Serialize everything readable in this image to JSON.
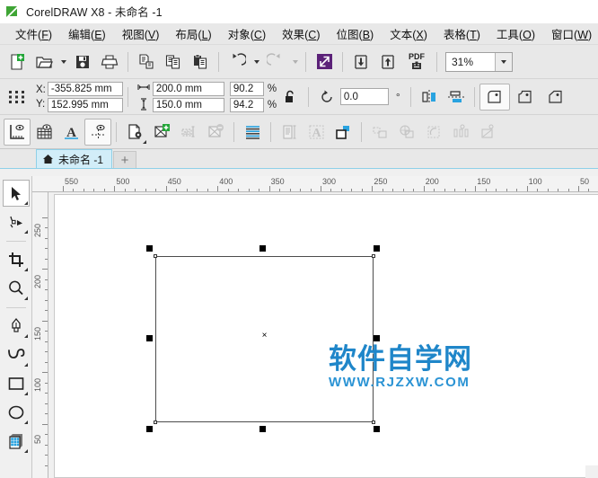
{
  "window": {
    "title": "CorelDRAW X8 - 未命名 -1",
    "logo_icon": "coreldraw-logo-icon"
  },
  "menubar": {
    "items": [
      {
        "label": "文件",
        "accel": "F"
      },
      {
        "label": "编辑",
        "accel": "E"
      },
      {
        "label": "视图",
        "accel": "V"
      },
      {
        "label": "布局",
        "accel": "L"
      },
      {
        "label": "对象",
        "accel": "C"
      },
      {
        "label": "效果",
        "accel": "C"
      },
      {
        "label": "位图",
        "accel": "B"
      },
      {
        "label": "文本",
        "accel": "X"
      },
      {
        "label": "表格",
        "accel": "T"
      },
      {
        "label": "工具",
        "accel": "O"
      },
      {
        "label": "窗口",
        "accel": "W"
      }
    ]
  },
  "main_toolbar": {
    "buttons": [
      {
        "name": "new-document-button",
        "icon": "new-page-icon"
      },
      {
        "name": "open-document-button",
        "icon": "open-folder-icon"
      },
      {
        "name": "save-document-button",
        "icon": "floppy-save-icon"
      },
      {
        "name": "print-button",
        "icon": "printer-icon"
      },
      {
        "name": "cut-button",
        "icon": "cut-icon"
      },
      {
        "name": "copy-button",
        "icon": "copy-icon"
      },
      {
        "name": "paste-button",
        "icon": "paste-icon"
      },
      {
        "name": "undo-button",
        "icon": "undo-arrow-icon"
      },
      {
        "name": "redo-button",
        "icon": "redo-arrow-icon"
      },
      {
        "name": "search-content-button",
        "icon": "fullscreen-arrows-icon"
      },
      {
        "name": "import-button",
        "icon": "import-down-arrow-icon"
      },
      {
        "name": "export-button",
        "icon": "export-up-arrow-icon"
      },
      {
        "name": "publish-pdf-button",
        "icon": "pdf-icon"
      }
    ],
    "pdf_label": "PDF",
    "zoom": {
      "value": "31%",
      "name": "zoom-level-combo"
    }
  },
  "property_bar": {
    "object_position_icon": "object-handles-icon",
    "x_label": "X:",
    "y_label": "Y:",
    "x_value": "-355.825 mm",
    "y_value": "152.995 mm",
    "width_value": "200.0 mm",
    "height_value": "150.0 mm",
    "width_icon": "horizontal-size-icon",
    "height_icon": "vertical-size-icon",
    "scale_x": "90.2",
    "scale_y": "94.2",
    "percent_symbol": "%",
    "lock_ratio_icon": "lock-open-icon",
    "rotation_icon": "rotation-icon",
    "rotation_value": "0.0",
    "degree_symbol": "°",
    "mirror_horizontal_icon": "mirror-horizontal-icon",
    "mirror_vertical_icon": "mirror-vertical-icon",
    "corner_round_icon": "round-corner-icon",
    "corner_scallop_icon": "scallop-corner-icon",
    "corner_chamfer_icon": "chamfer-corner-icon"
  },
  "third_toolbar": {
    "buttons": [
      {
        "name": "show-rulers-button",
        "icon": "ruler-eye-icon",
        "state": "pressed"
      },
      {
        "name": "show-grid-button",
        "icon": "grid-eye-icon",
        "state": "normal"
      },
      {
        "name": "show-text-button",
        "icon": "text-baseline-icon",
        "state": "normal"
      },
      {
        "name": "show-guidelines-button",
        "icon": "guideline-eye-icon",
        "state": "pressed"
      },
      {
        "name": "document-options-button",
        "icon": "page-gear-icon",
        "state": "normal"
      },
      {
        "name": "add-page-button",
        "icon": "page-plus-icon",
        "state": "normal"
      },
      {
        "name": "rename-page-button",
        "icon": "rename-page-icon",
        "state": "disabled"
      },
      {
        "name": "delete-page-button",
        "icon": "page-minus-icon",
        "state": "disabled"
      },
      {
        "name": "text-align-button",
        "icon": "align-lines-icon",
        "state": "normal"
      },
      {
        "name": "paragraph-text-button",
        "icon": "paragraph-icon",
        "state": "disabled"
      },
      {
        "name": "convert-text-button",
        "icon": "convert-text-icon",
        "state": "disabled"
      },
      {
        "name": "shape-tool-button",
        "icon": "shape-square-icon",
        "state": "normal"
      },
      {
        "name": "align-objects-button",
        "icon": "align-objects-icon",
        "state": "disabled"
      },
      {
        "name": "weld-button",
        "icon": "weld-shapes-icon",
        "state": "disabled"
      },
      {
        "name": "trim-button",
        "icon": "trim-shapes-icon",
        "state": "disabled"
      },
      {
        "name": "distribute-button",
        "icon": "distribute-icon",
        "state": "disabled"
      },
      {
        "name": "transform-button",
        "icon": "transform-icon",
        "state": "disabled"
      }
    ]
  },
  "document_tab": {
    "home_icon": "home-icon",
    "label": "未命名 -1",
    "add_tab_label": "+"
  },
  "toolbox": {
    "tools": [
      {
        "name": "pick-tool",
        "icon": "cursor-arrow-icon",
        "active": true
      },
      {
        "name": "shape-edit-tool",
        "icon": "shape-node-icon",
        "active": false
      },
      {
        "name": "crop-tool",
        "icon": "crop-icon",
        "active": false
      },
      {
        "name": "zoom-tool",
        "icon": "magnifier-icon",
        "active": false
      },
      {
        "name": "freehand-tool",
        "icon": "pen-nib-icon",
        "active": false
      },
      {
        "name": "artistic-media-tool",
        "icon": "artistic-curve-icon",
        "active": false
      },
      {
        "name": "rectangle-tool",
        "icon": "rectangle-icon",
        "active": false
      },
      {
        "name": "ellipse-tool",
        "icon": "ellipse-icon",
        "active": false
      },
      {
        "name": "graph-paper-tool",
        "icon": "graph-paper-icon",
        "active": false
      }
    ]
  },
  "rulers": {
    "horizontal_unit_icon": "ruler-origin-icon",
    "horizontal_labels": [
      "550",
      "500",
      "450",
      "400",
      "350",
      "300",
      "250",
      "200",
      "150",
      "100",
      "50"
    ],
    "vertical_labels": [
      "250",
      "200",
      "150",
      "100",
      "50"
    ]
  },
  "canvas": {
    "selected_object": {
      "name": "selected-rectangle",
      "handle_count": 8,
      "center_marker": "×"
    },
    "watermark": {
      "main": "软件自学网",
      "sub": "WWW.RJZXW.COM"
    }
  },
  "colors": {
    "accent_purple": "#5B2178",
    "tab_blue": "#d2edf8",
    "watermark_blue": "#1f86c9",
    "toolbar_bg": "#e8e8e8",
    "canvas_bg": "#f0f0f0",
    "icon_blue": "#29a3e0",
    "logo_green": "#3fa535"
  }
}
